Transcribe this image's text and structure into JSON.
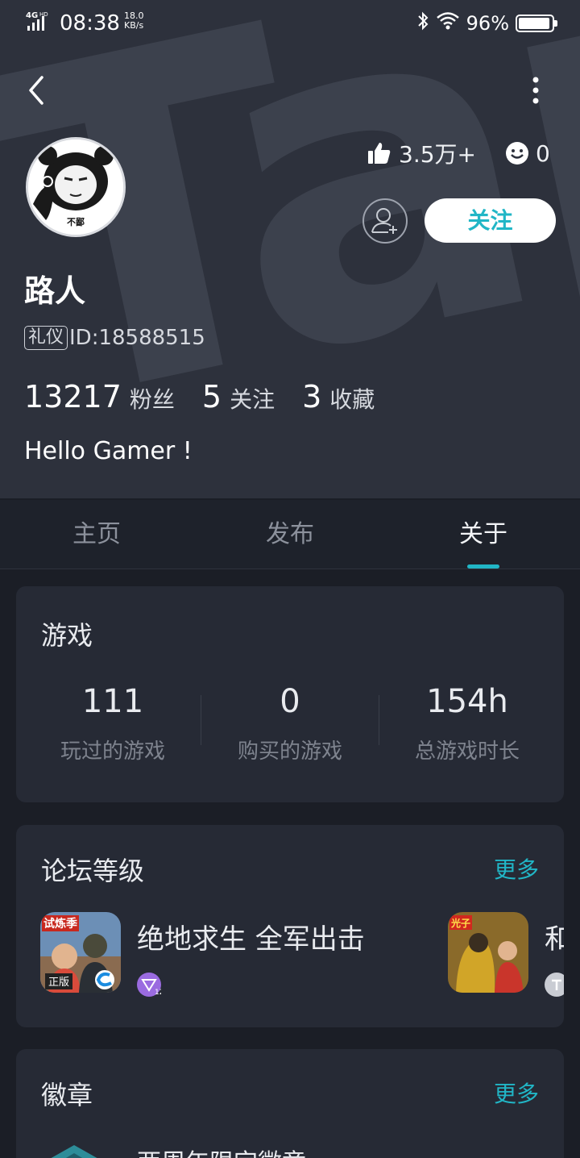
{
  "status_bar": {
    "network": "4G",
    "time": "08:38",
    "speed_value": "18.0",
    "speed_unit": "KB/s",
    "battery": "96%",
    "battery_level": 0.96
  },
  "profile": {
    "avatar_caption": "不鄙",
    "likes": "3.5万+",
    "smiles": "0",
    "follow_label": "关注",
    "username": "路人",
    "tag": "礼仪",
    "id_text": "ID:18588515",
    "fans_count": "13217",
    "fans_label": "粉丝",
    "following_count": "5",
    "following_label": "关注",
    "favorites_count": "3",
    "favorites_label": "收藏",
    "bio": "Hello Gamer !"
  },
  "tabs": [
    {
      "label": "主页"
    },
    {
      "label": "发布"
    },
    {
      "label": "关于"
    }
  ],
  "active_tab": "关于",
  "games_card": {
    "title": "游戏",
    "stats": [
      {
        "value": "111",
        "label": "玩过的游戏"
      },
      {
        "value": "0",
        "label": "购买的游戏"
      },
      {
        "value": "154h",
        "label": "总游戏时长"
      }
    ]
  },
  "forum_card": {
    "title": "论坛等级",
    "more": "更多",
    "items": [
      {
        "name": "绝地求生 全军出击",
        "icon_tag_top": "试炼季",
        "icon_tag_bottom": "正版",
        "badge_number": "12"
      },
      {
        "name": "和",
        "icon_tag_top": "光子"
      }
    ]
  },
  "badges_card": {
    "title": "徽章",
    "more": "更多",
    "first_badge": "两周年限定徽章"
  },
  "colors": {
    "accent": "#21b6c6",
    "header_bg": "#2d313c",
    "page_bg": "#1b1e26",
    "card_bg": "#262a35"
  }
}
